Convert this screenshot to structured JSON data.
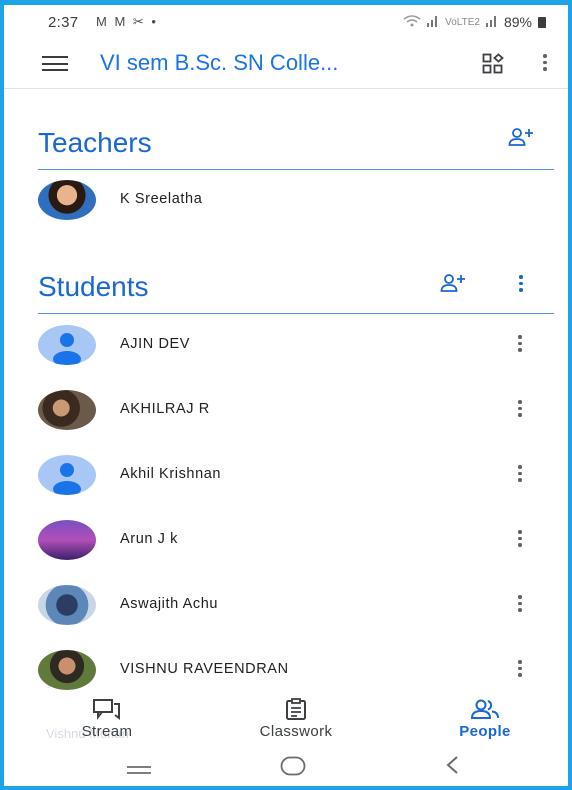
{
  "status_bar": {
    "time": "2:37",
    "notif_icons": "M M ✂ •",
    "network": "VoLTE2",
    "battery": "89%"
  },
  "app_bar": {
    "title": "VI sem B.Sc. SN Colle..."
  },
  "teachers": {
    "heading": "Teachers",
    "items": [
      {
        "name": "K Sreelatha",
        "avatar": "photo"
      }
    ]
  },
  "students": {
    "heading": "Students",
    "items": [
      {
        "name": "AJIN DEV",
        "avatar": "default"
      },
      {
        "name": "AKHILRAJ R",
        "avatar": "photo"
      },
      {
        "name": "Akhil Krishnan",
        "avatar": "default"
      },
      {
        "name": "Arun J k",
        "avatar": "photo"
      },
      {
        "name": "Aswajith Achu",
        "avatar": "photo"
      },
      {
        "name": "VISHNU RAVEENDRAN",
        "avatar": "photo"
      }
    ],
    "partially_hidden_name": "Vishnu Mohan"
  },
  "bottom_nav": {
    "items": [
      {
        "label": "Stream",
        "icon": "stream-icon",
        "active": false
      },
      {
        "label": "Classwork",
        "icon": "classwork-icon",
        "active": false
      },
      {
        "label": "People",
        "icon": "people-icon",
        "active": true
      }
    ]
  },
  "colors": {
    "accent": "#1967d2",
    "frame": "#1ea3e6",
    "divider": "#5a8fdc"
  }
}
